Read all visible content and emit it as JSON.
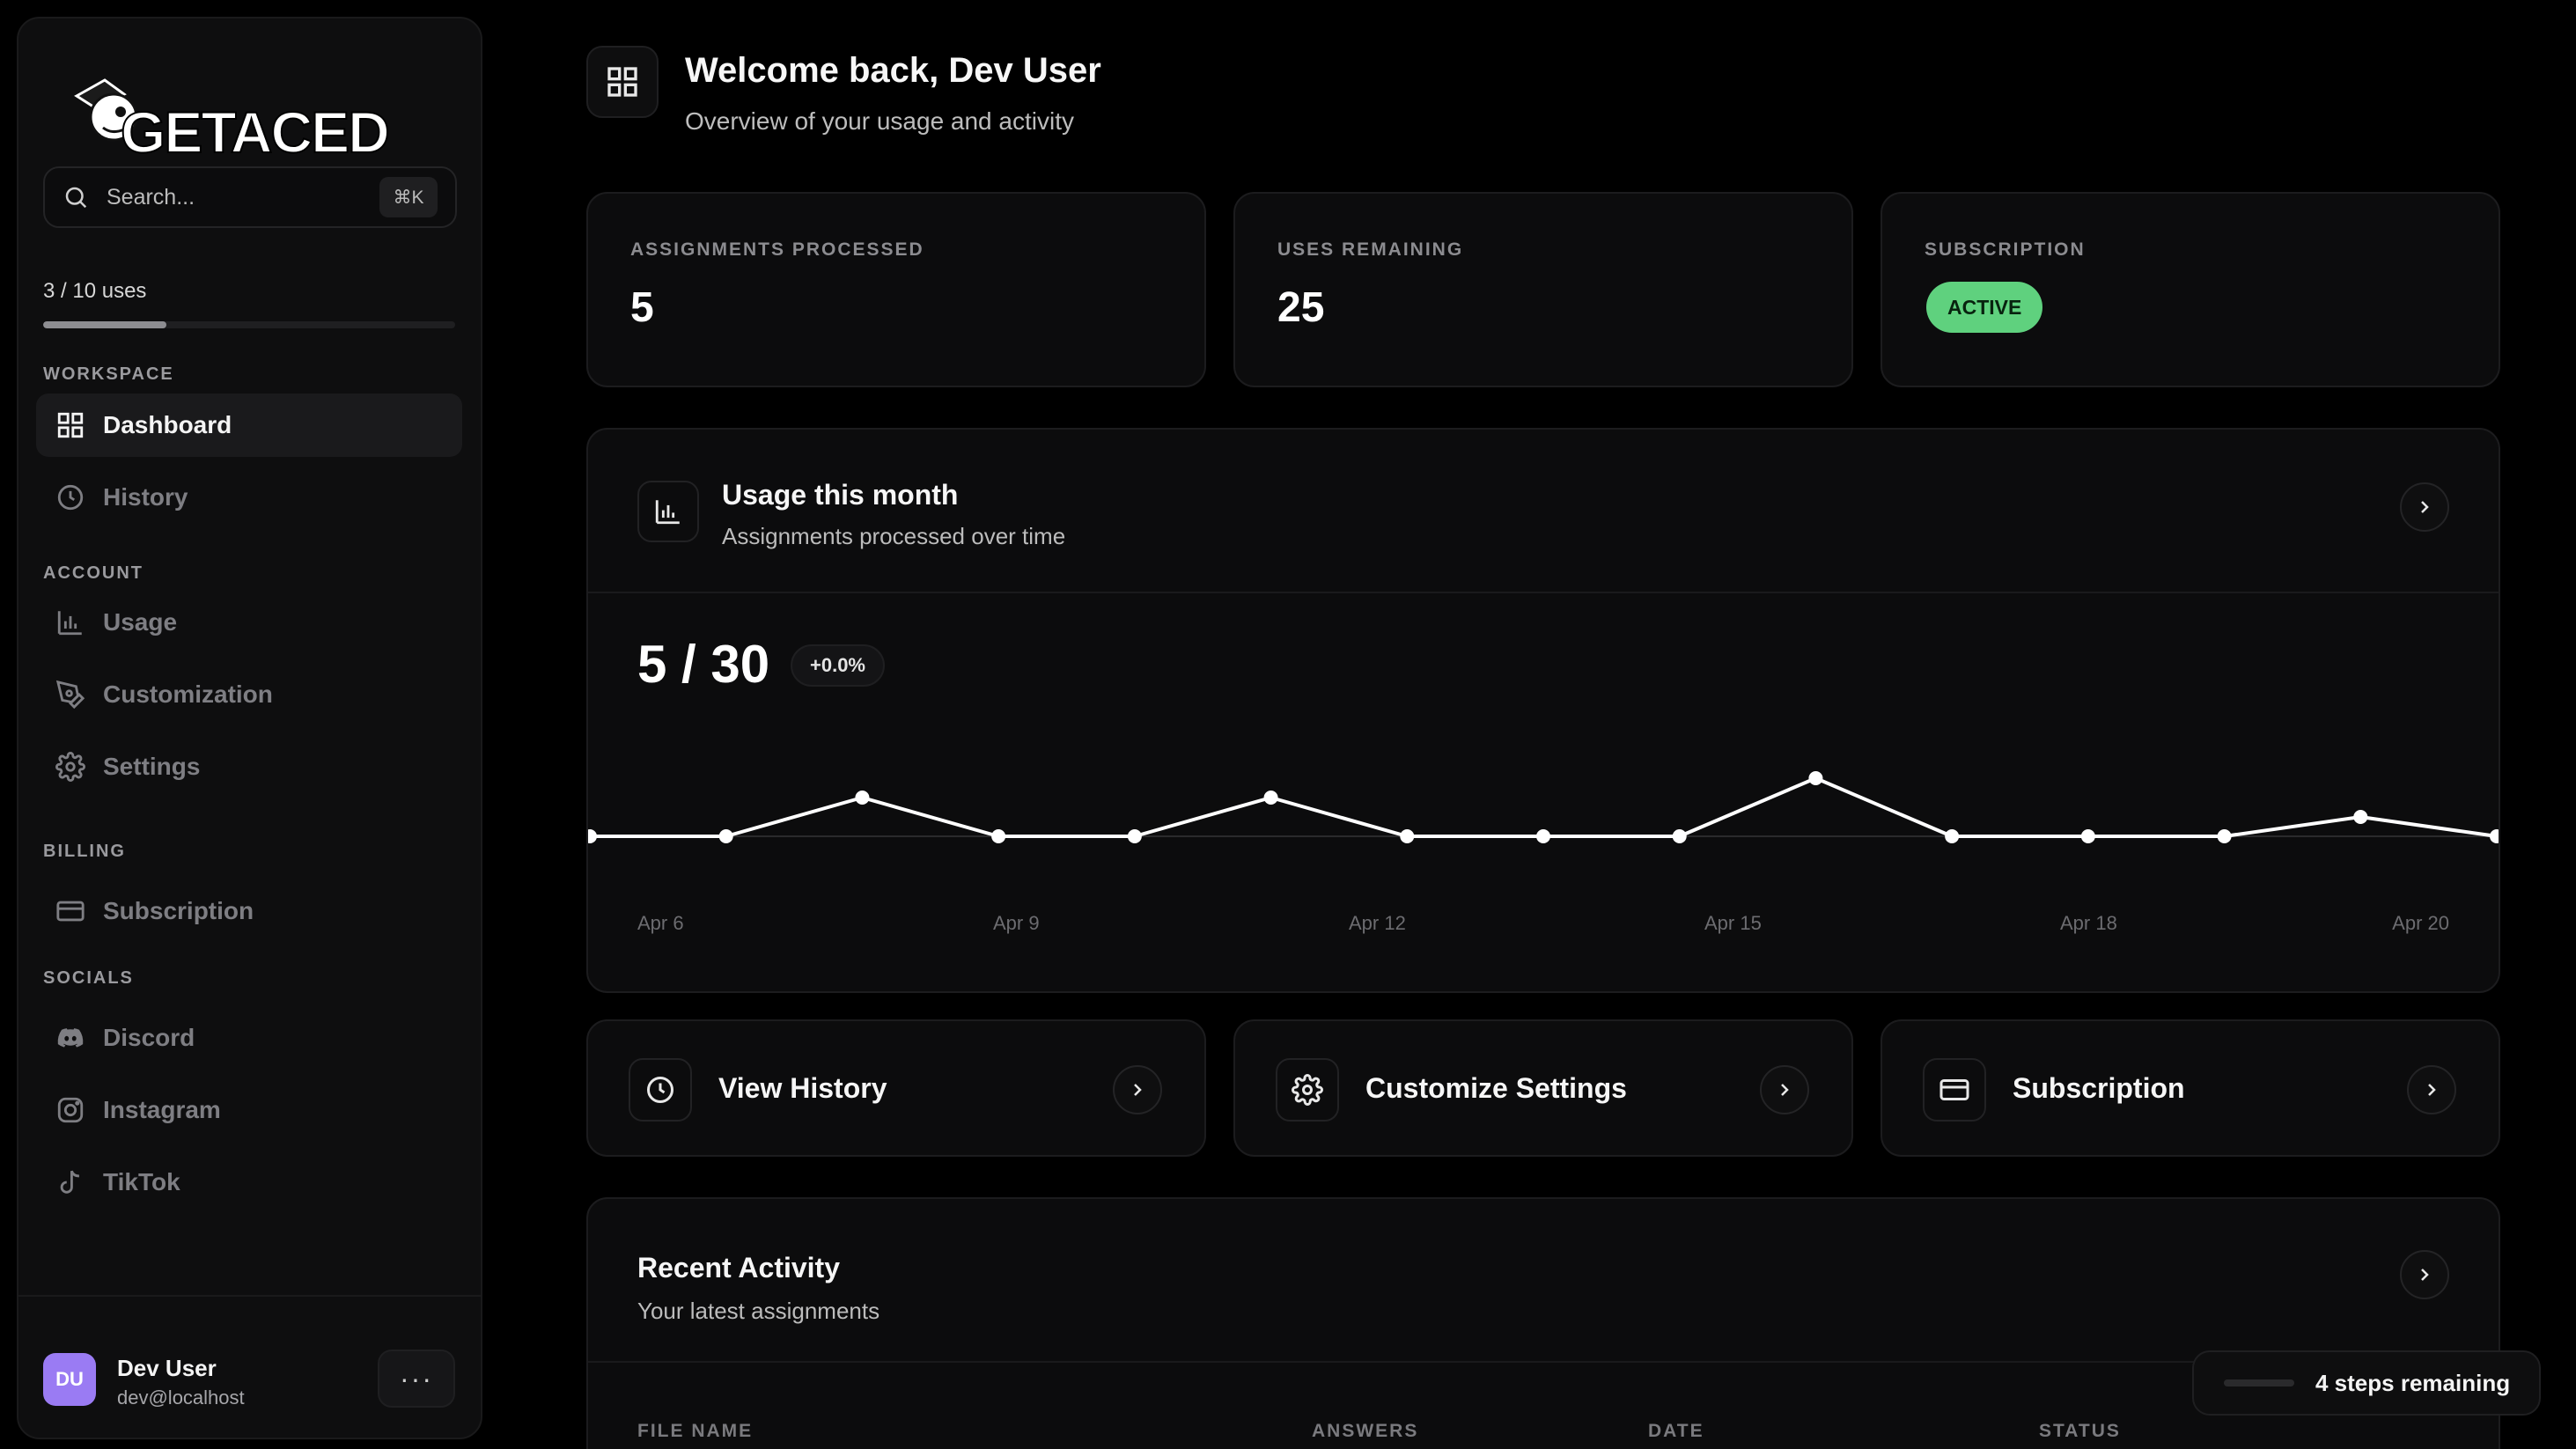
{
  "brand": {
    "logo_text": "GETACED"
  },
  "search": {
    "placeholder": "Search...",
    "shortcut": "⌘K"
  },
  "usage_meter": {
    "label": "3 / 10 uses",
    "used": 3,
    "total": 10
  },
  "sidebar": {
    "sections": {
      "workspace": "WORKSPACE",
      "account": "ACCOUNT",
      "billing": "BILLING",
      "socials": "SOCIALS"
    },
    "items": [
      {
        "label": "Dashboard",
        "icon": "grid-icon",
        "active": true
      },
      {
        "label": "History",
        "icon": "clock-icon"
      },
      {
        "label": "Usage",
        "icon": "bar-chart-icon"
      },
      {
        "label": "Customization",
        "icon": "pen-tool-icon"
      },
      {
        "label": "Settings",
        "icon": "gear-icon"
      },
      {
        "label": "Subscription",
        "icon": "credit-card-icon"
      },
      {
        "label": "Discord",
        "icon": "discord-icon"
      },
      {
        "label": "Instagram",
        "icon": "instagram-icon"
      },
      {
        "label": "TikTok",
        "icon": "tiktok-icon"
      }
    ]
  },
  "user": {
    "initials": "DU",
    "name": "Dev User",
    "email": "dev@localhost",
    "menu": "···"
  },
  "header": {
    "title": "Welcome back, Dev User",
    "subtitle": "Overview of your usage and activity"
  },
  "stats": [
    {
      "label": "ASSIGNMENTS PROCESSED",
      "value": "5"
    },
    {
      "label": "USES REMAINING",
      "value": "25"
    },
    {
      "label": "SUBSCRIPTION",
      "badge": "ACTIVE"
    }
  ],
  "usage_card": {
    "title": "Usage this month",
    "subtitle": "Assignments processed over time",
    "total": "5 / 30",
    "delta": "+0.0%"
  },
  "chart_data": {
    "type": "line",
    "x": [
      "Apr 6",
      "Apr 7",
      "Apr 8",
      "Apr 9",
      "Apr 10",
      "Apr 11",
      "Apr 12",
      "Apr 13",
      "Apr 14",
      "Apr 15",
      "Apr 16",
      "Apr 17",
      "Apr 18",
      "Apr 19",
      "Apr 20"
    ],
    "x_tick_labels": [
      "Apr 6",
      "Apr 9",
      "Apr 12",
      "Apr 15",
      "Apr 18",
      "Apr 20"
    ],
    "values": [
      0,
      0,
      1,
      0,
      0,
      1,
      0,
      0,
      0,
      1.5,
      0,
      0,
      0,
      0.5,
      0
    ],
    "ylim": [
      0,
      1.5
    ],
    "grid": false,
    "line_color": "#ffffff"
  },
  "actions": [
    {
      "label": "View History",
      "icon": "clock-icon"
    },
    {
      "label": "Customize Settings",
      "icon": "gear-icon"
    },
    {
      "label": "Subscription",
      "icon": "credit-card-icon"
    }
  ],
  "recent_activity": {
    "title": "Recent Activity",
    "subtitle": "Your latest assignments",
    "columns": [
      "FILE NAME",
      "ANSWERS",
      "DATE",
      "STATUS"
    ]
  },
  "onboarding": {
    "label": "4 steps remaining"
  },
  "colors": {
    "background": "#000000",
    "card": "#0c0c0d",
    "accent_green": "#5fd17e",
    "avatar": "#9a7bf3"
  }
}
